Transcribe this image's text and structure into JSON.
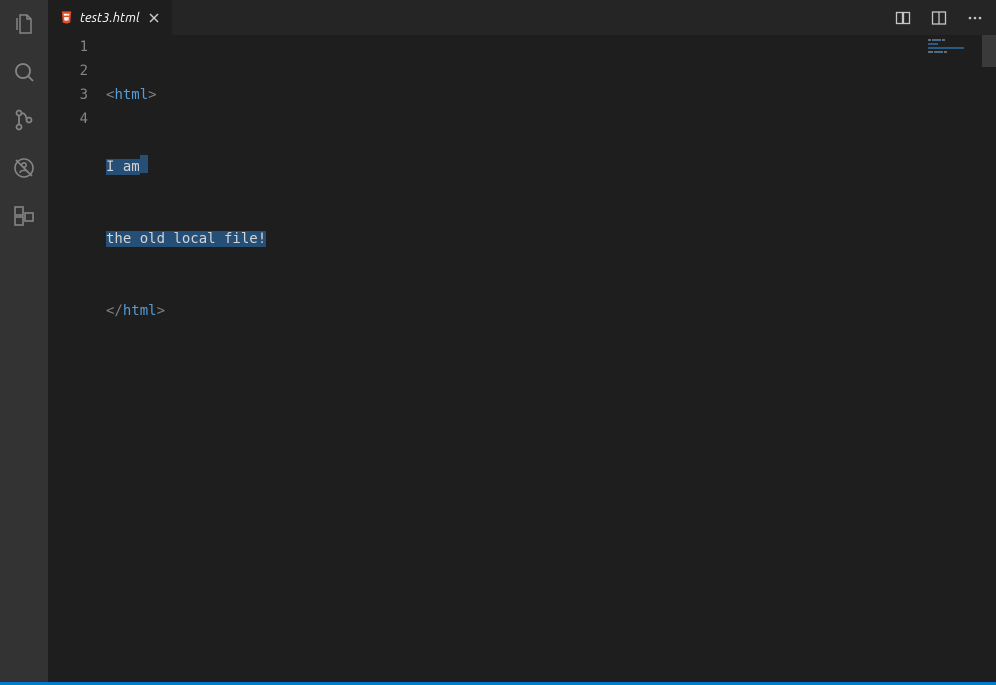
{
  "tab": {
    "filename": "test3.html",
    "file_icon": "html5-icon",
    "close_label": "×"
  },
  "activity": {
    "items": [
      {
        "name": "explorer-icon"
      },
      {
        "name": "search-icon"
      },
      {
        "name": "source-control-icon"
      },
      {
        "name": "debug-icon"
      },
      {
        "name": "extensions-icon"
      }
    ]
  },
  "editor_actions": {
    "compare": "compare-icon",
    "split": "split-editor-icon",
    "more": "…"
  },
  "code": {
    "line_numbers": [
      "1",
      "2",
      "3",
      "4"
    ],
    "lines": {
      "l1": {
        "open": "<",
        "tag": "html",
        "close": ">"
      },
      "l2": {
        "text": "I am"
      },
      "l3": {
        "text": "the old local file!"
      },
      "l4": {
        "open": "</",
        "tag": "html",
        "close": ">"
      }
    }
  },
  "colors": {
    "bg": "#1e1e1e",
    "activity_bg": "#333333",
    "tabbar_bg": "#252526",
    "selection": "#264f78",
    "tag_color": "#569cd6",
    "punct_color": "#808080",
    "gutter_color": "#858585",
    "status_blue": "#007acc"
  }
}
